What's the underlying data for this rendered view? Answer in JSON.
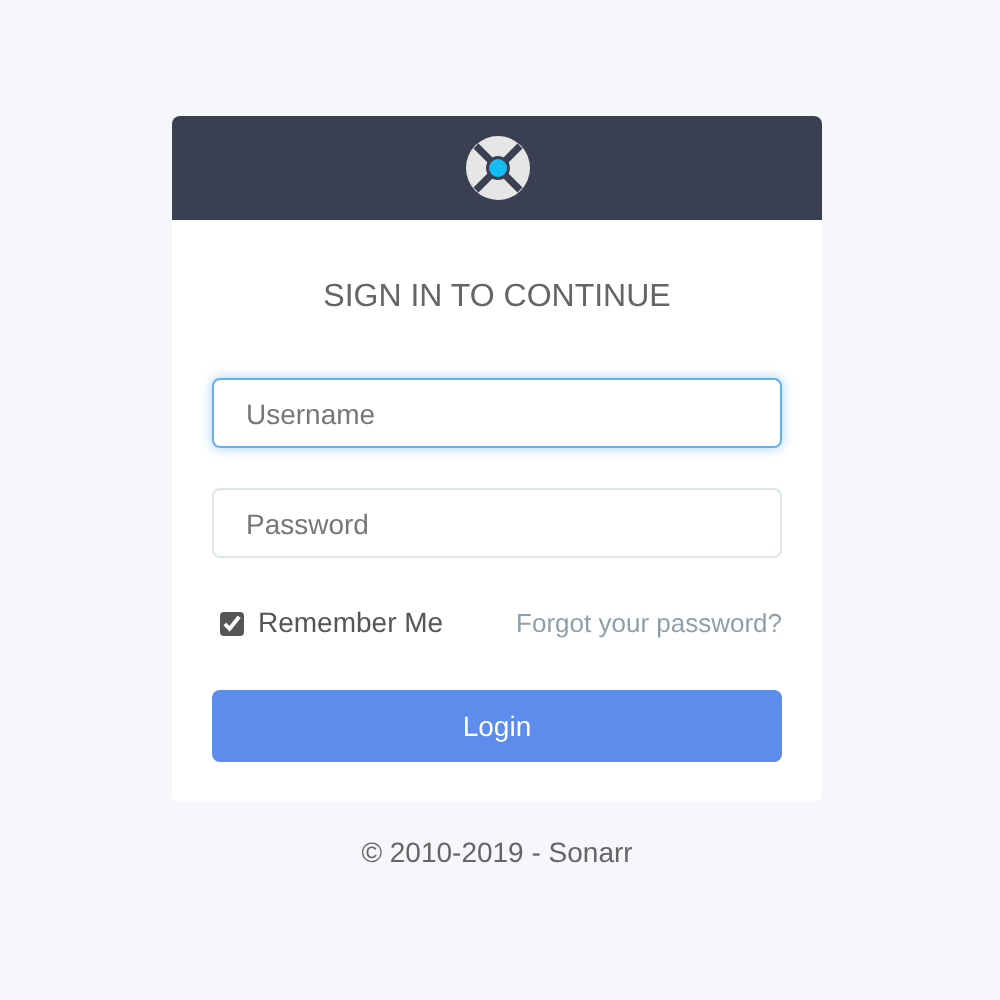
{
  "heading": "SIGN IN TO CONTINUE",
  "fields": [
    {
      "placeholder": "Username",
      "focused": true
    },
    {
      "placeholder": "Password",
      "focused": false
    }
  ],
  "remember": {
    "label": "Remember Me",
    "checked": true
  },
  "forgot_link": "Forgot your password?",
  "login_button": "Login",
  "footer": "© 2010-2019 - Sonarr"
}
